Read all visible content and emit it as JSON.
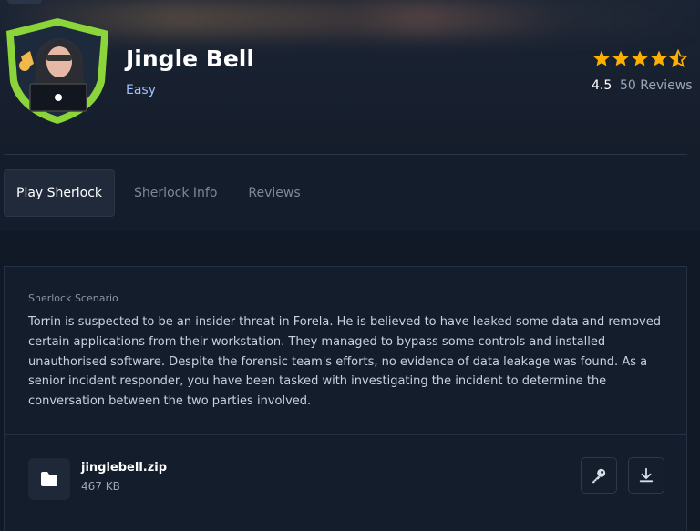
{
  "header": {
    "title": "Jingle Bell",
    "difficulty": "Easy",
    "rating": "4.5",
    "reviews_label": "50 Reviews",
    "rating_value": 4.5,
    "star_color": "#ffaf00"
  },
  "tabs": [
    {
      "label": "Play Sherlock",
      "active": true
    },
    {
      "label": "Sherlock Info",
      "active": false
    },
    {
      "label": "Reviews",
      "active": false
    }
  ],
  "scenario": {
    "label": "Sherlock Scenario",
    "text": "Torrin is suspected to be an insider threat in Forela. He is believed to have leaked some data and removed certain applications from their workstation. They managed to bypass some controls and installed unauthorised software. Despite the forensic team's efforts, no evidence of data leakage was found. As a senior incident responder, you have been tasked with investigating the incident to determine the conversation between the two parties involved."
  },
  "file": {
    "name": "jinglebell.zip",
    "size": "467 KB",
    "icon": "folder-icon",
    "actions": [
      "key-icon",
      "download-icon"
    ]
  },
  "colors": {
    "accent_green": "#8bd43a",
    "difficulty": "#9fc0ff"
  }
}
